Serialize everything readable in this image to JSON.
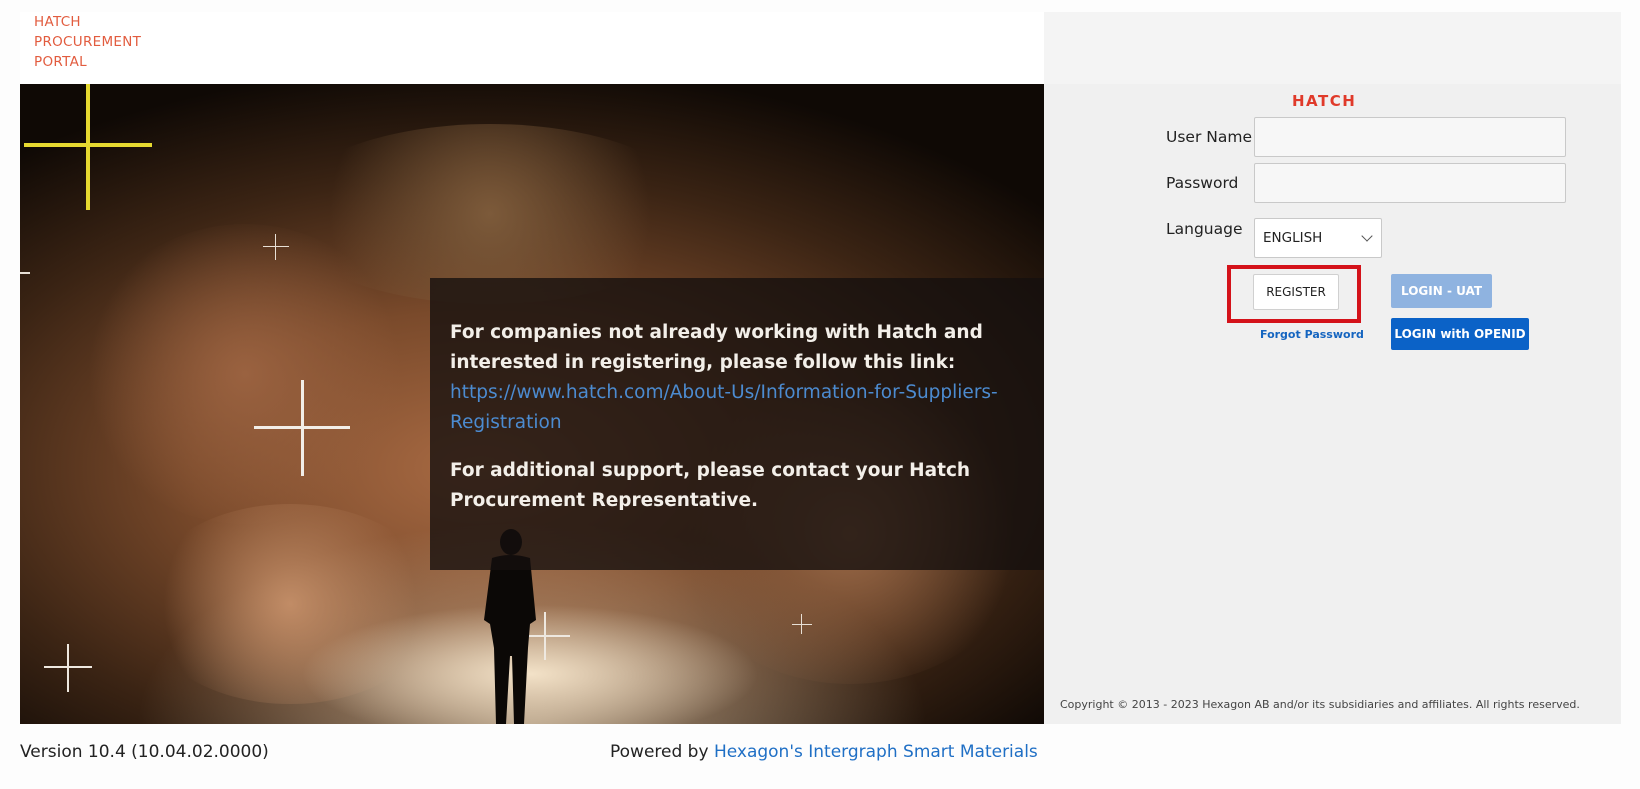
{
  "header": {
    "logo_lines": [
      "HATCH",
      "PROCUREMENT",
      "PORTAL"
    ]
  },
  "hero": {
    "message_1": "For companies not already working with Hatch and interested in registering, please follow this link:",
    "link_text": "https://www.hatch.com/About-Us/Information-for-Suppliers-Registration",
    "message_2": "For additional support, please contact your Hatch Procurement Representative."
  },
  "login": {
    "brand": "HATCH",
    "username_label": "User Name",
    "username_value": "",
    "password_label": "Password",
    "password_value": "",
    "language_label": "Language",
    "language_selected": "ENGLISH",
    "register_label": "REGISTER",
    "forgot_password_label": "Forgot Password",
    "login_uat_label": "LOGIN - UAT",
    "login_openid_label": "LOGIN with OPENID",
    "copyright": "Copyright © 2013 - 2023 Hexagon AB and/or its subsidiaries and affiliates. All rights reserved."
  },
  "footer": {
    "version": "Version 10.4 (10.04.02.0000)",
    "powered_prefix": "Powered by ",
    "powered_link": "Hexagon's Intergraph Smart Materials"
  },
  "colors": {
    "brand_orange": "#e25c3f",
    "brand_red": "#e03a2a",
    "primary_blue": "#0b62c7",
    "disabled_blue": "#8fb3e0",
    "highlight_red": "#d4121a"
  }
}
